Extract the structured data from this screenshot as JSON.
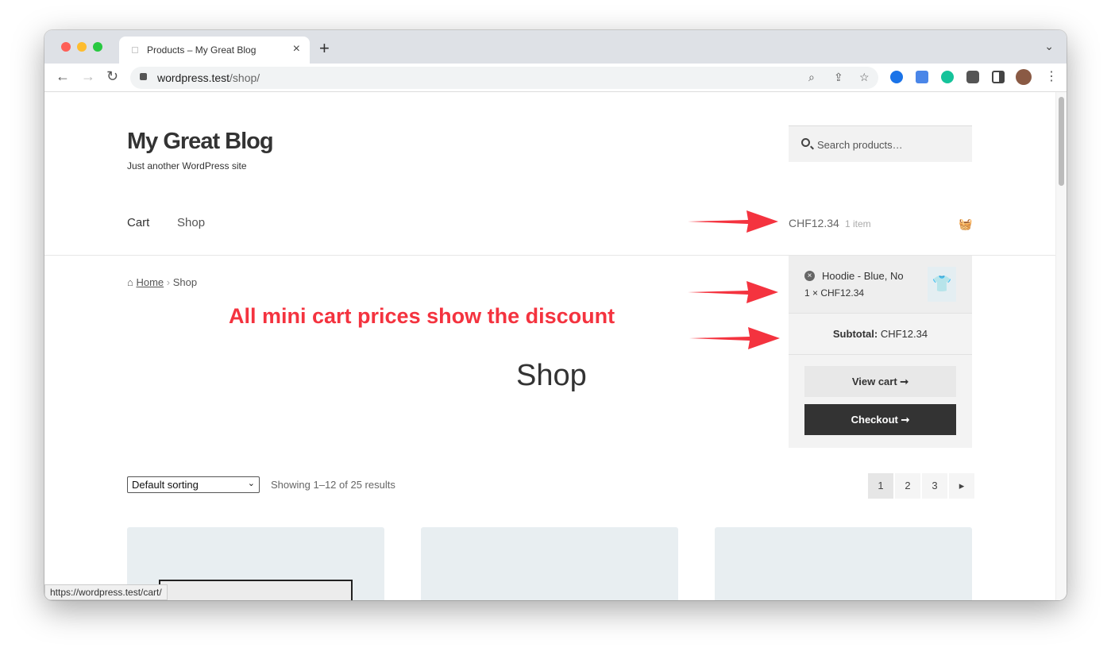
{
  "browser": {
    "tab_title": "Products – My Great Blog",
    "url_host": "wordpress.test",
    "url_path": "/shop/",
    "status_url": "https://wordpress.test/cart/"
  },
  "site": {
    "title": "My Great Blog",
    "tagline": "Just another WordPress site",
    "search_placeholder": "Search products…"
  },
  "nav": {
    "items": [
      {
        "label": "Cart"
      },
      {
        "label": "Shop"
      }
    ]
  },
  "header_cart": {
    "amount": "CHF12.34",
    "count": "1 item"
  },
  "breadcrumb": {
    "home": "Home",
    "sep": "›",
    "current": "Shop"
  },
  "annotation": "All mini cart prices show the discount",
  "page_title": "Shop",
  "mini_cart": {
    "item_name": "Hoodie - Blue, No",
    "item_qty": "1 × CHF12.34",
    "subtotal_label": "Subtotal:",
    "subtotal_value": "CHF12.34",
    "view_cart": "View cart ➞",
    "checkout": "Checkout ➞"
  },
  "toolbar": {
    "sorting": "Default sorting",
    "results": "Showing 1–12 of 25 results",
    "pages": [
      "1",
      "2",
      "3"
    ],
    "next": "▸"
  },
  "colors": {
    "annotation": "#f4333f",
    "checkout_bg": "#333333"
  }
}
